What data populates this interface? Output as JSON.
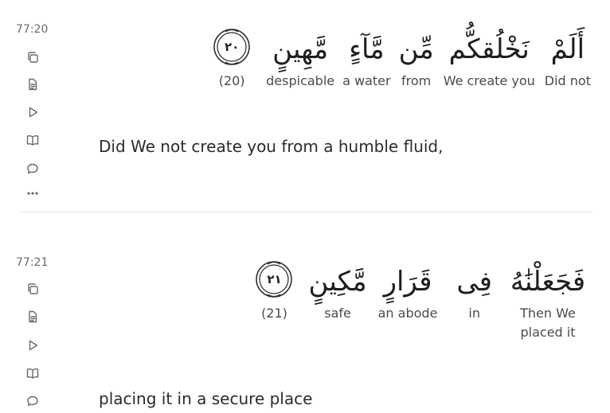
{
  "verses": [
    {
      "key": "77:20",
      "marker_number": "٢٠",
      "marker_label": "(20)",
      "words": [
        {
          "arabic": "أَلَمْ",
          "translation": "Did not"
        },
        {
          "arabic": "نَخْلُقكُّم",
          "translation": "We create you"
        },
        {
          "arabic": "مِّن",
          "translation": "from"
        },
        {
          "arabic": "مَّآءٍ",
          "translation": "a water"
        },
        {
          "arabic": "مَّهِينٍ",
          "translation": "despicable"
        }
      ],
      "translation": "Did We not create you from a humble fluid,"
    },
    {
      "key": "77:21",
      "marker_number": "٢١",
      "marker_label": "(21)",
      "words": [
        {
          "arabic": "فَجَعَلْنَٰهُ",
          "translation": "Then We placed it"
        },
        {
          "arabic": "فِى",
          "translation": "in"
        },
        {
          "arabic": "قَرَارٍ",
          "translation": "an abode"
        },
        {
          "arabic": "مَّكِينٍ",
          "translation": "safe"
        }
      ],
      "translation": "placing it in a secure place"
    }
  ],
  "action_icons": [
    "copy-icon",
    "tafsir-icon",
    "play-icon",
    "book-icon",
    "comment-icon",
    "more-icon"
  ],
  "colors": {
    "text": "#2b2b2b",
    "muted": "#6b6b6b",
    "divider": "#e9e9e9"
  }
}
